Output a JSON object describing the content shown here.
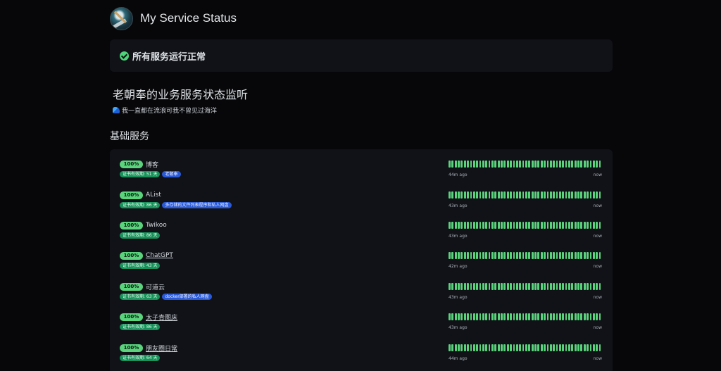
{
  "header": {
    "title": "My Service Status"
  },
  "overall_status": {
    "text": "所有服务运行正常"
  },
  "description": {
    "title": "老朝奉的业务服务状态监听",
    "subtitle": "我一直都在流浪可我不曾见过海洋"
  },
  "section": {
    "title": "基础服务"
  },
  "colors": {
    "up": "#5ad37c",
    "cert": "#18925a",
    "tag": "#2a5ad8",
    "card": "#101218"
  },
  "services": [
    {
      "uptime": "100%",
      "name": "博客",
      "link": false,
      "cert": "证书有效期: 51 天",
      "tag": "老朝奉",
      "since": "44m ago",
      "now": "now",
      "beats": 50
    },
    {
      "uptime": "100%",
      "name": "AList",
      "link": false,
      "cert": "证书有效期: 86 天",
      "tag": "多存储的文件列表程序和私人网盘",
      "since": "43m ago",
      "now": "now",
      "beats": 50
    },
    {
      "uptime": "100%",
      "name": "Twikoo",
      "link": false,
      "cert": "证书有效期: 86 天",
      "tag": "",
      "since": "43m ago",
      "now": "now",
      "beats": 50
    },
    {
      "uptime": "100%",
      "name": "ChatGPT",
      "link": true,
      "cert": "证书有效期: 43 天",
      "tag": "",
      "since": "42m ago",
      "now": "now",
      "beats": 50
    },
    {
      "uptime": "100%",
      "name": "可道云",
      "link": false,
      "cert": "证书有效期: 63 天",
      "tag": "docker部署的私人网盘",
      "since": "43m ago",
      "now": "now",
      "beats": 50
    },
    {
      "uptime": "100%",
      "name": "太子青图床",
      "link": true,
      "cert": "证书有效期: 86 天",
      "tag": "",
      "since": "43m ago",
      "now": "now",
      "beats": 50
    },
    {
      "uptime": "100%",
      "name": "朋友圈日常",
      "link": true,
      "cert": "证书有效期: 64 天",
      "tag": "",
      "since": "44m ago",
      "now": "now",
      "beats": 50
    }
  ]
}
